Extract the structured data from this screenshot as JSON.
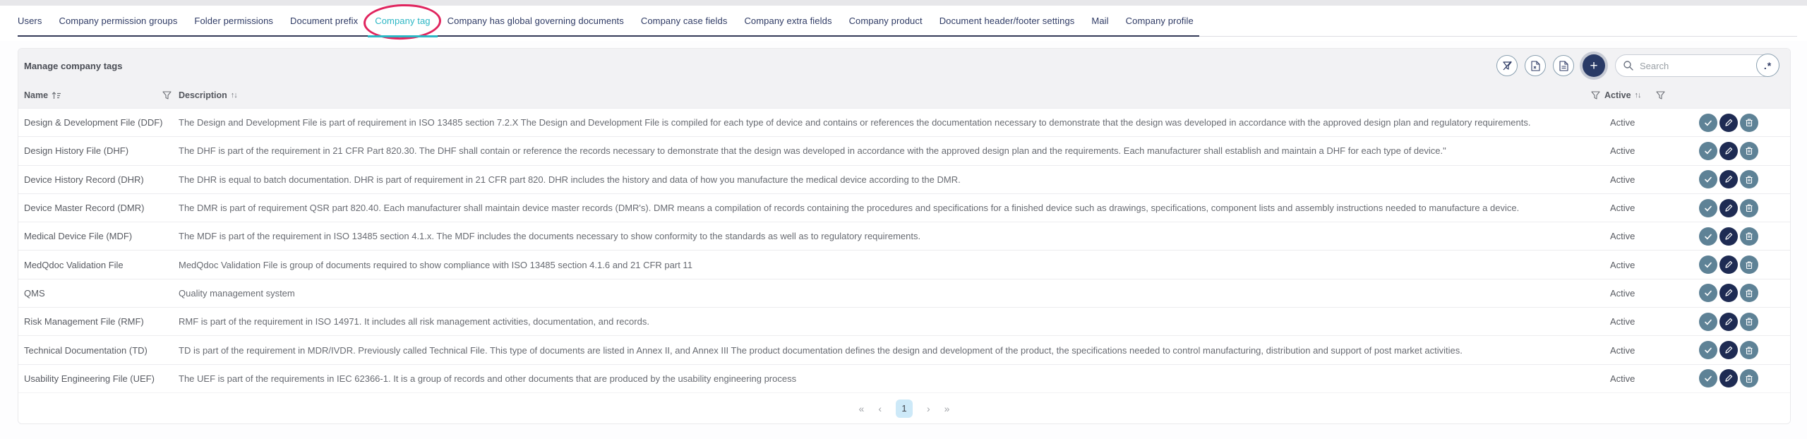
{
  "colors": {
    "accent_teal": "#2bb6c4",
    "tab_navy": "#2e3a64",
    "annotation_red": "#e0245e",
    "band_gray": "#f2f2f4",
    "steel_button": "#5e8296",
    "navy_button": "#1e2b53",
    "add_button": "#293a66",
    "page_badge_blue": "#cde9f8"
  },
  "tabs": [
    {
      "label": "Users",
      "active": false
    },
    {
      "label": "Company permission groups",
      "active": false
    },
    {
      "label": "Folder permissions",
      "active": false
    },
    {
      "label": "Document prefix",
      "active": false
    },
    {
      "label": "Company tag",
      "active": true
    },
    {
      "label": "Company has global governing documents",
      "active": false
    },
    {
      "label": "Company case fields",
      "active": false
    },
    {
      "label": "Company extra fields",
      "active": false
    },
    {
      "label": "Company product",
      "active": false
    },
    {
      "label": "Document header/footer settings",
      "active": false
    },
    {
      "label": "Mail",
      "active": false
    },
    {
      "label": "Company profile",
      "active": false
    }
  ],
  "panel": {
    "title": "Manage company tags",
    "toolbar": {
      "icons": [
        "filter-off-icon",
        "file-export-icon",
        "file-document-icon"
      ],
      "add_label": "+",
      "search_placeholder": "Search",
      "regex_label": ".*"
    },
    "table": {
      "headers": {
        "name": "Name",
        "description": "Description",
        "active": "Active"
      },
      "sort_arrows": "↑↓",
      "rows": [
        {
          "name": "Design & Development File (DDF)",
          "description": "The Design and Development File is part of requirement in ISO 13485 section 7.2.X The Design and Development File is compiled for each type of device and contains or references the documentation necessary to demonstrate that the design was developed in accordance with the approved design plan and regulatory requirements.",
          "status": "Active"
        },
        {
          "name": "Design History File (DHF)",
          "description": "The DHF is part of the requirement in 21 CFR Part 820.30. The DHF shall contain or reference the records necessary to demonstrate that the design was developed in accordance with the approved design plan and the requirements. Each manufacturer shall establish and maintain a DHF for each type of device.\"",
          "status": "Active"
        },
        {
          "name": "Device History Record (DHR)",
          "description": "The DHR is equal to batch documentation. DHR is part of requirement in 21 CFR part 820. DHR includes the history and data of how you manufacture the medical device according to the DMR.",
          "status": "Active"
        },
        {
          "name": "Device Master Record (DMR)",
          "description": "The DMR is part of requirement QSR part 820.40. Each manufacturer shall maintain device master records (DMR's). DMR means a compilation of records containing the procedures and specifications for a finished device such as drawings, specifications, component lists and assembly instructions needed to manufacture a device.",
          "status": "Active"
        },
        {
          "name": "Medical Device File (MDF)",
          "description": "The MDF is part of the requirement in ISO 13485 section 4.1.x. The MDF includes the documents necessary to show conformity to the standards as well as to regulatory requirements.",
          "status": "Active"
        },
        {
          "name": "MedQdoc Validation File",
          "description": "MedQdoc Validation File is group of documents required to show compliance with ISO 13485 section 4.1.6 and 21 CFR part 11",
          "status": "Active"
        },
        {
          "name": "QMS",
          "description": "Quality management system",
          "status": "Active"
        },
        {
          "name": "Risk Management File (RMF)",
          "description": "RMF is part of the requirement in ISO 14971. It includes all risk management activities, documentation, and records.",
          "status": "Active"
        },
        {
          "name": "Technical Documentation (TD)",
          "description": "TD is part of the requirement in MDR/IVDR. Previously called Technical File. This type of documents are listed in Annex II, and Annex III The product documentation defines the design and development of the product, the specifications needed to control manufacturing, distribution and support of post market activities.",
          "status": "Active"
        },
        {
          "name": "Usability Engineering File (UEF)",
          "description": "The UEF is part of the requirements in IEC 62366-1. It is a group of records and other documents that are produced by the usability engineering process",
          "status": "Active"
        }
      ]
    },
    "pagination": {
      "first": "«",
      "prev": "‹",
      "page": "1",
      "next": "›",
      "last": "»"
    }
  }
}
